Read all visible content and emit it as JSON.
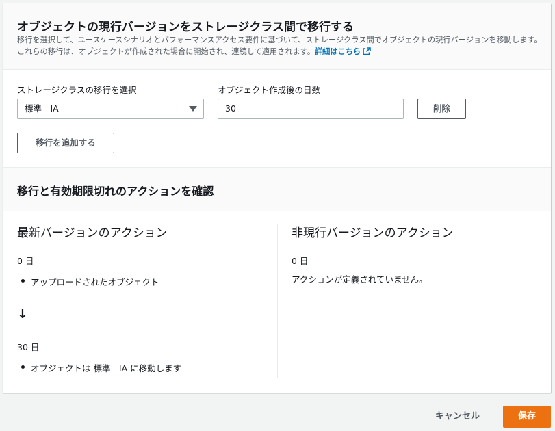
{
  "header": {
    "title": "オブジェクトの現行バージョンをストレージクラス間で移行する",
    "description": "移行を選択して、ユースケースシナリオとパフォーマンスアクセス要件に基づいて、ストレージクラス間でオブジェクトの現行バージョンを移動します。これらの移行は、オブジェクトが作成された場合に開始され、連続して適用されます。",
    "info_link": "詳細はこちら"
  },
  "form": {
    "storage_class_label": "ストレージクラスの移行を選択",
    "storage_class_value": "標準 - IA",
    "days_label": "オブジェクト作成後の日数",
    "days_value": "30",
    "remove_button": "削除",
    "add_transition_button": "移行を追加する"
  },
  "review": {
    "title": "移行と有効期限切れのアクションを確認",
    "current": {
      "title": "最新バージョンのアクション",
      "day0": "0 日",
      "day0_action": "アップロードされたオブジェクト",
      "arrow": "↓",
      "day30": "30 日",
      "day30_action": "オブジェクトは 標準 - IA に移動します"
    },
    "noncurrent": {
      "title": "非現行バージョンのアクション",
      "day0": "0 日",
      "message": "アクションが定義されていません。"
    }
  },
  "footer": {
    "cancel": "キャンセル",
    "save": "保存"
  },
  "colors": {
    "primary": "#ec7211",
    "link": "#0073bb",
    "text": "#16191f",
    "secondary_text": "#545b64"
  },
  "icons": [
    "external-link-icon",
    "caret-down-icon",
    "arrow-down-icon"
  ]
}
